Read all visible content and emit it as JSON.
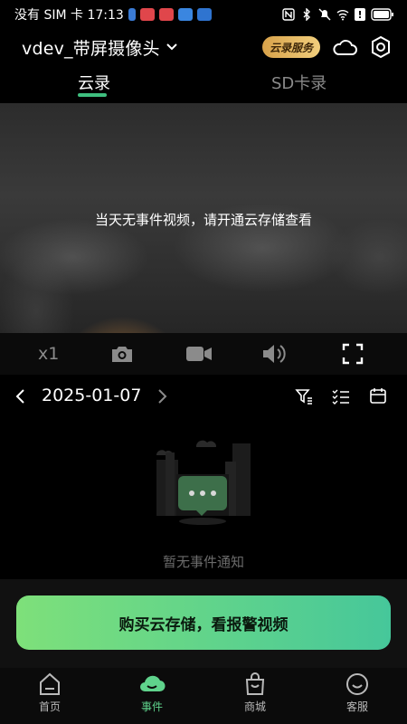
{
  "status_bar": {
    "left_text": "没有 SIM 卡 17:13",
    "battery_text": "!"
  },
  "header": {
    "device_title": "vdev_带屏摄像头",
    "cloud_service_label": "云录服务"
  },
  "tabs": [
    {
      "label": "云录",
      "active": true
    },
    {
      "label": "SD卡录",
      "active": false
    }
  ],
  "video": {
    "message": "当天无事件视频，请开通云存储查看"
  },
  "controls": {
    "speed_label": "x1"
  },
  "date_nav": {
    "date": "2025-01-07"
  },
  "empty_state": {
    "text": "暂无事件通知"
  },
  "buy_button": {
    "label": "购买云存储，看报警视频"
  },
  "bottom_nav": [
    {
      "label": "首页",
      "icon": "home-icon",
      "active": false
    },
    {
      "label": "事件",
      "icon": "cloud-icon",
      "active": true
    },
    {
      "label": "商城",
      "icon": "shopping-bag-icon",
      "active": false
    },
    {
      "label": "客服",
      "icon": "smile-face-icon",
      "active": false
    }
  ],
  "colors": {
    "accent": "#5fd38c",
    "gold": "#e3b35d",
    "background": "#000000"
  }
}
